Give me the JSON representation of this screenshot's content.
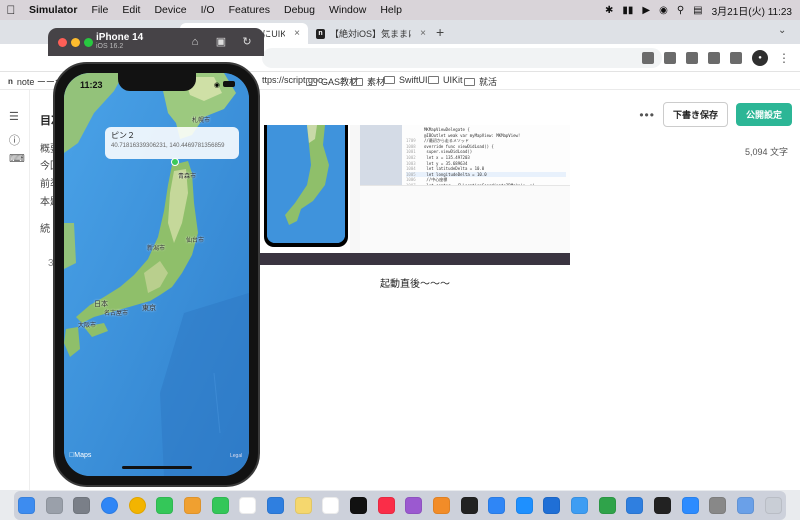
{
  "menubar": {
    "app_name": "Simulator",
    "menus": [
      "File",
      "Edit",
      "Device",
      "I/O",
      "Features",
      "Debug",
      "Window",
      "Help"
    ],
    "clock": "3月21日(火) 11:23"
  },
  "browser": {
    "tabs": [
      {
        "title": "【iOS】気ままにUIKit54〜M"
      },
      {
        "title": "【絶対iOS】気ままにUIKit52〜M"
      }
    ],
    "bookmarks": [
      "note ーーつく",
      "ttps://script.goo...",
      "GAS教材",
      "素材",
      "SwiftUI",
      "UIKit",
      "就活"
    ]
  },
  "editor": {
    "toc_title": "目次",
    "toc_items": [
      "概要",
      "今回",
      "前準",
      "本題",
      "続"
    ],
    "toc_number": "3",
    "draft_button": "下書き保存",
    "publish_button": "公開設定",
    "word_count": "5,094 文字",
    "caption": "起動直後〜〜〜",
    "code_lines": [
      {
        "n": "",
        "t": "MKMapViewDelegate {"
      },
      {
        "n": "",
        "t": "@IBOutlet weak var myMapView: MKMapView!"
      },
      {
        "n": "1709",
        "t": "//最初から走るメソッド"
      },
      {
        "n": "1008",
        "t": "override func viewDidLoad() {"
      },
      {
        "n": "1001",
        "t": "    super.viewDidLoad()"
      },
      {
        "n": "1002",
        "t": "    let x = 135.497203"
      },
      {
        "n": "1003",
        "t": "    let y = 35.689634"
      },
      {
        "n": "1004",
        "t": "    let latitudeDelta = 10.0"
      },
      {
        "n": "1005",
        "t": "    let longitudeDelta = 10.0"
      },
      {
        "n": "1006",
        "t": "    //中心座標"
      },
      {
        "n": "1007",
        "t": "    let center = CLLocationCoordinate2DMake(y, x)"
      },
      {
        "n": "1008",
        "t": "    //表示範囲"
      }
    ]
  },
  "simulator": {
    "device_name": "iPhone 14",
    "os_version": "iOS 16.2",
    "status_time": "11:23",
    "pin_title": "ピン２",
    "pin_coords": "40.71816339306231, 140.4469781356859",
    "attribution": "Maps",
    "legal": "Legal",
    "labels": {
      "sapporo": "札幌市",
      "aomori": "青森市",
      "sendai": "仙台市",
      "niigata": "新潟市",
      "nihon": "日本",
      "tokyo": "東京",
      "nagoya": "名古屋市",
      "osaka": "大阪市"
    }
  },
  "dock": {
    "apps": [
      "finder",
      "launchpad",
      "settings",
      "safari",
      "chrome",
      "messages",
      "photos",
      "facetime",
      "calendar",
      "files",
      "notes",
      "reminders",
      "tv",
      "music",
      "podcasts",
      "books",
      "hd-app",
      "keynote",
      "appstore",
      "xcode",
      "testflight",
      "numbers",
      "simulator",
      "terminal",
      "zoom",
      "calculator",
      "preview",
      "trash"
    ]
  }
}
